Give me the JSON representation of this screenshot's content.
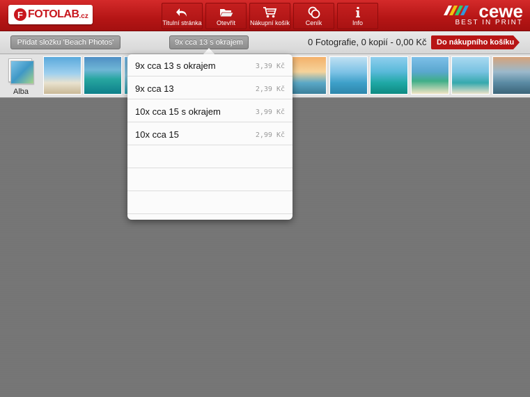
{
  "brand": {
    "logo_text": "FOTOLAB",
    "logo_suffix": ".cz",
    "logo_mark": "F",
    "partner_word": "cewe",
    "partner_tagline": "BEST IN PRINT"
  },
  "nav": [
    {
      "label": "Titulní stránka",
      "icon": "undo-arrow-icon"
    },
    {
      "label": "Otevřít",
      "icon": "open-folder-icon"
    },
    {
      "label": "Nákupní košík",
      "icon": "cart-icon"
    },
    {
      "label": "Ceník",
      "icon": "coins-icon"
    },
    {
      "label": "Info",
      "icon": "info-icon"
    }
  ],
  "toolbar": {
    "add_folder_label": "Přidat složku 'Beach Photos'",
    "format_label": "9x cca 13 s okrajem",
    "summary": "0 Fotografie, 0 kopií - 0,00 Kč",
    "cart_label": "Do nákupního košíku"
  },
  "strip": {
    "albums_label": "Alba"
  },
  "format_options": [
    {
      "name": "9x cca 13 s okrajem",
      "price": "3,39 Kč"
    },
    {
      "name": "9x cca 13",
      "price": "2,39 Kč"
    },
    {
      "name": "10x cca 15 s okrajem",
      "price": "3,99 Kč"
    },
    {
      "name": "10x cca 15",
      "price": "2,99 Kč"
    }
  ],
  "colors": {
    "brand_red": "#c8161d",
    "bar_red": "#b51515",
    "background": "#757575"
  }
}
